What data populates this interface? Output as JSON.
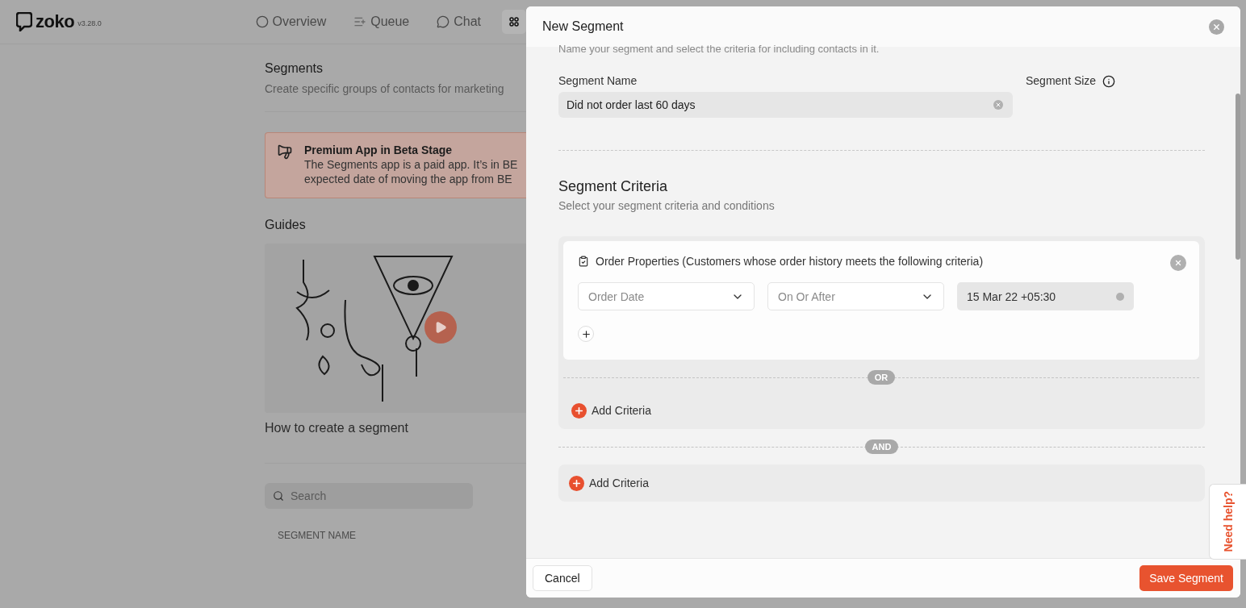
{
  "app": {
    "logo": "zoko",
    "version": "v3.28.0"
  },
  "nav": [
    {
      "kind": "overview",
      "label": "Overview"
    },
    {
      "kind": "queue",
      "label": "Queue"
    },
    {
      "kind": "chat",
      "label": "Chat"
    },
    {
      "kind": "apps"
    }
  ],
  "page": {
    "title": "Segments",
    "subtitle": "Create specific groups of contacts for marketing",
    "banner": {
      "title": "Premium App in Beta Stage",
      "lines": [
        "The Segments app is a paid app. It’s in BE",
        "expected date of moving the app from BE"
      ]
    },
    "guides": {
      "title": "Guides",
      "video": {
        "kind": "picture",
        "title": "How to create a segment"
      }
    },
    "search": {
      "placeholder": "Search"
    },
    "table": {
      "columns": [
        "SEGMENT NAME"
      ]
    }
  },
  "modal": {
    "title": "New Segment",
    "subtitle": "Name your segment and select the criteria for including contacts in it.",
    "name_field": {
      "label": "Segment Name",
      "value": "Did not order last 60 days"
    },
    "size_label": "Segment Size",
    "criteria": {
      "title": "Segment Criteria",
      "subtitle": "Select your segment criteria and conditions",
      "joiner": "AND",
      "groups": [
        {
          "cards": [
            {
              "title": "Order Properties (Customers whose order history meets the following criteria)",
              "fields": [
                {
                  "kind": "select",
                  "placeholder": "Order Date"
                },
                {
                  "kind": "select",
                  "placeholder": "On Or After"
                },
                {
                  "kind": "date",
                  "value": "15 Mar 22 +05:30"
                }
              ]
            }
          ],
          "separator": "OR",
          "add_label": "Add Criteria"
        },
        {
          "add_label": "Add Criteria"
        }
      ]
    },
    "cancel": "Cancel",
    "save": "Save Segment"
  },
  "help": "Need help?"
}
